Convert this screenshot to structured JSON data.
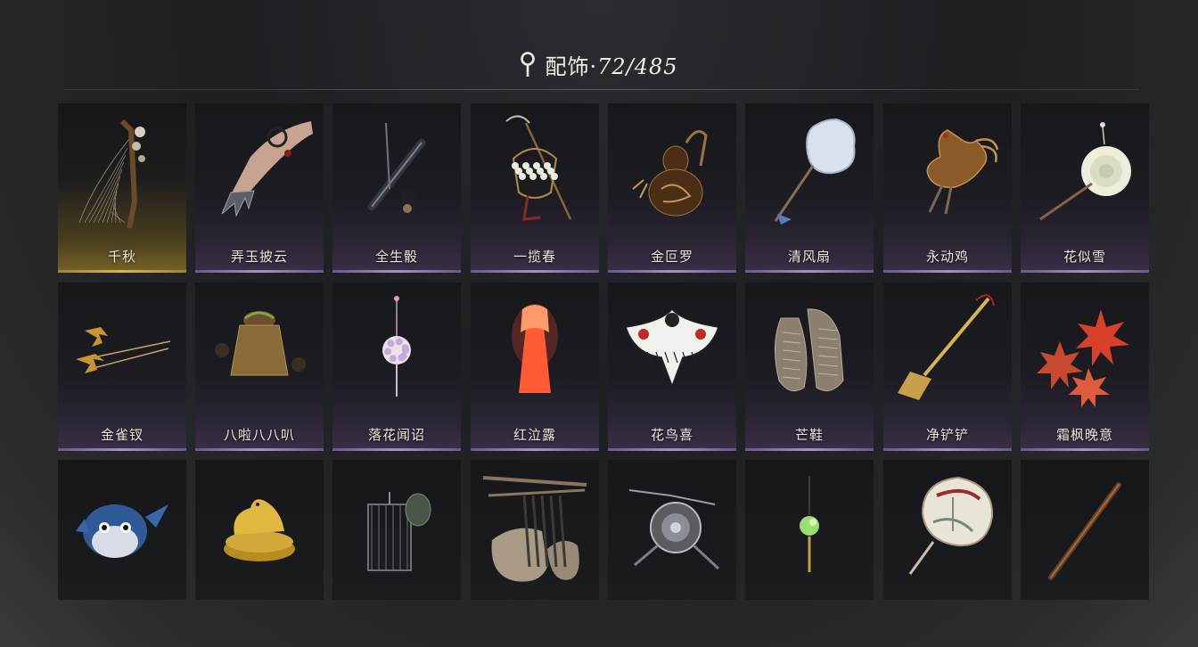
{
  "header": {
    "title": "配饰",
    "separator": "·",
    "count": "72/485"
  },
  "items": [
    {
      "name": "千秋",
      "icon": "harp-flower-icon",
      "selected": true
    },
    {
      "name": "弄玉披云",
      "icon": "claw-gauntlet-icon"
    },
    {
      "name": "全生骰",
      "icon": "flute-ornament-icon"
    },
    {
      "name": "一揽春",
      "icon": "flower-basket-hoe-icon"
    },
    {
      "name": "金叵罗",
      "icon": "gourd-flask-icon"
    },
    {
      "name": "清风扇",
      "icon": "round-fan-icon"
    },
    {
      "name": "永动鸡",
      "icon": "mechanical-rooster-icon"
    },
    {
      "name": "花似雪",
      "icon": "white-flower-hairpin-icon"
    },
    {
      "name": "金雀钗",
      "icon": "golden-bird-hairpin-icon"
    },
    {
      "name": "八啦八八叭",
      "icon": "bronze-bell-creature-icon"
    },
    {
      "name": "落花闻诏",
      "icon": "flower-ball-pendant-icon"
    },
    {
      "name": "红泣露",
      "icon": "red-ghost-doll-icon"
    },
    {
      "name": "花鸟喜",
      "icon": "swallow-kite-icon"
    },
    {
      "name": "芒鞋",
      "icon": "straw-sandals-icon"
    },
    {
      "name": "净铲铲",
      "icon": "golden-shovel-icon"
    },
    {
      "name": "霜枫晚意",
      "icon": "maple-leaves-icon"
    },
    {
      "name": "",
      "icon": "blue-bird-plush-icon"
    },
    {
      "name": "",
      "icon": "golden-bird-nest-icon"
    },
    {
      "name": "",
      "icon": "bamboo-lantern-cage-icon"
    },
    {
      "name": "",
      "icon": "traveler-backpack-icon"
    },
    {
      "name": "",
      "icon": "round-shield-blades-icon"
    },
    {
      "name": "",
      "icon": "jade-pendant-icon"
    },
    {
      "name": "",
      "icon": "painted-fan-icon"
    },
    {
      "name": "",
      "icon": "wooden-staff-icon"
    }
  ]
}
